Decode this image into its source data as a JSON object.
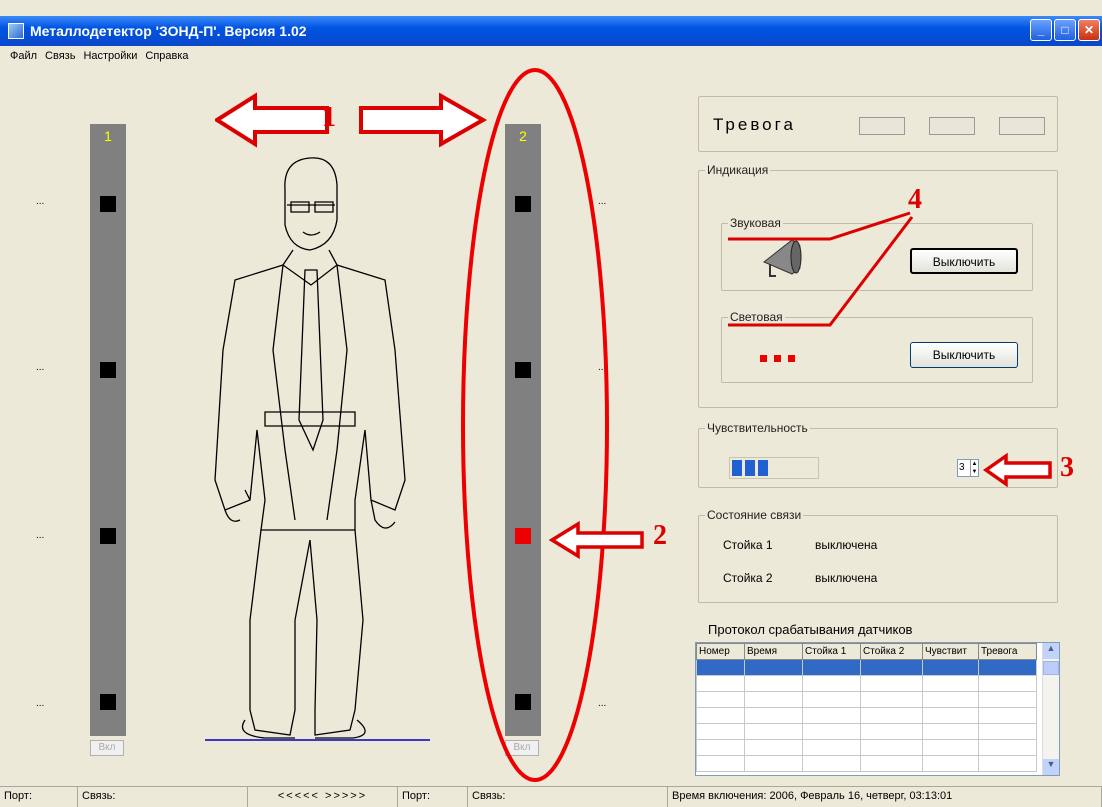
{
  "window": {
    "title": "Металлодетектор 'ЗОНД-П'. Версия 1.02"
  },
  "menu": [
    "Файл",
    "Связь",
    "Настройки",
    "Справка"
  ],
  "stands": [
    {
      "number": "1",
      "button_label": "Вкл"
    },
    {
      "number": "2",
      "button_label": "Вкл"
    }
  ],
  "side_marks": "...",
  "alarm": {
    "label": "Тревога"
  },
  "indication": {
    "label": "Индикация",
    "sound_label": "Звуковая",
    "sound_button": "Выключить",
    "light_label": "Световая",
    "light_button": "Выключить"
  },
  "sensitivity": {
    "label": "Чувствительность",
    "value": "3",
    "bar_level": 3
  },
  "connection": {
    "label": "Состояние связи",
    "rows": [
      {
        "name": "Стойка 1",
        "state": "выключена"
      },
      {
        "name": "Стойка 2",
        "state": "выключена"
      }
    ]
  },
  "protocol": {
    "title": "Протокол срабатывания датчиков",
    "columns": [
      "Номер",
      "Время",
      "Стойка 1",
      "Стойка 2",
      "Чувствит",
      "Тревога"
    ]
  },
  "status": {
    "port1": "Порт:",
    "link1": "Связь:",
    "arrows": "<<<<<  >>>>>",
    "port2": "Порт:",
    "link2": "Связь:",
    "start_time": "Время включения: 2006, Февраль 16, четверг,  03:13:01"
  },
  "annotations": [
    "1",
    "2",
    "3",
    "4"
  ],
  "colors": {
    "alarm_sensor": "#e00000",
    "annotation": "#dd0000",
    "title_bar": "#0054e3"
  }
}
